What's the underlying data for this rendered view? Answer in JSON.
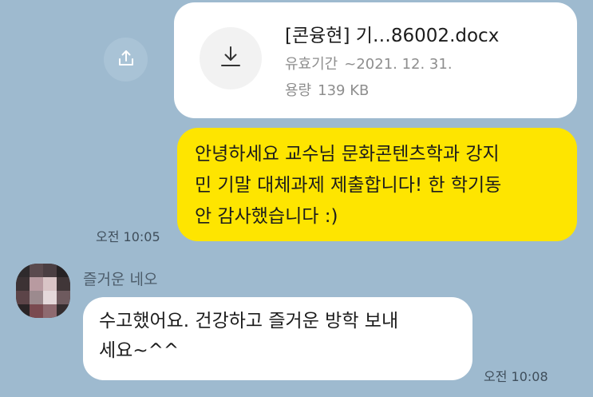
{
  "colors": {
    "background": "#9ebacf",
    "sent_bubble": "#fee500",
    "received_bubble": "#ffffff",
    "share_button": "#a9c3d6"
  },
  "share": {
    "icon": "share-icon"
  },
  "file_message": {
    "icon": "download-icon",
    "file_name": "[콘융현] 기…86002.docx",
    "expiry_label": "유효기간",
    "expiry_value": "~2021. 12. 31.",
    "size_label": "용량",
    "size_value": "139 KB"
  },
  "sent_message": {
    "lines": [
      "안녕하세요 교수님 문화콘텐츠학과 강지",
      "민 기말 대체과제 제출합니다! 한 학기동",
      "안 감사했습니다 :)"
    ],
    "time": "오전 10:05"
  },
  "received_message": {
    "sender": "즐거운 네오",
    "avatar": "avatar-pixelated",
    "lines": [
      "수고했어요. 건강하고 즐거운 방학 보내",
      "세요~^^"
    ],
    "time": "오전 10:08"
  }
}
